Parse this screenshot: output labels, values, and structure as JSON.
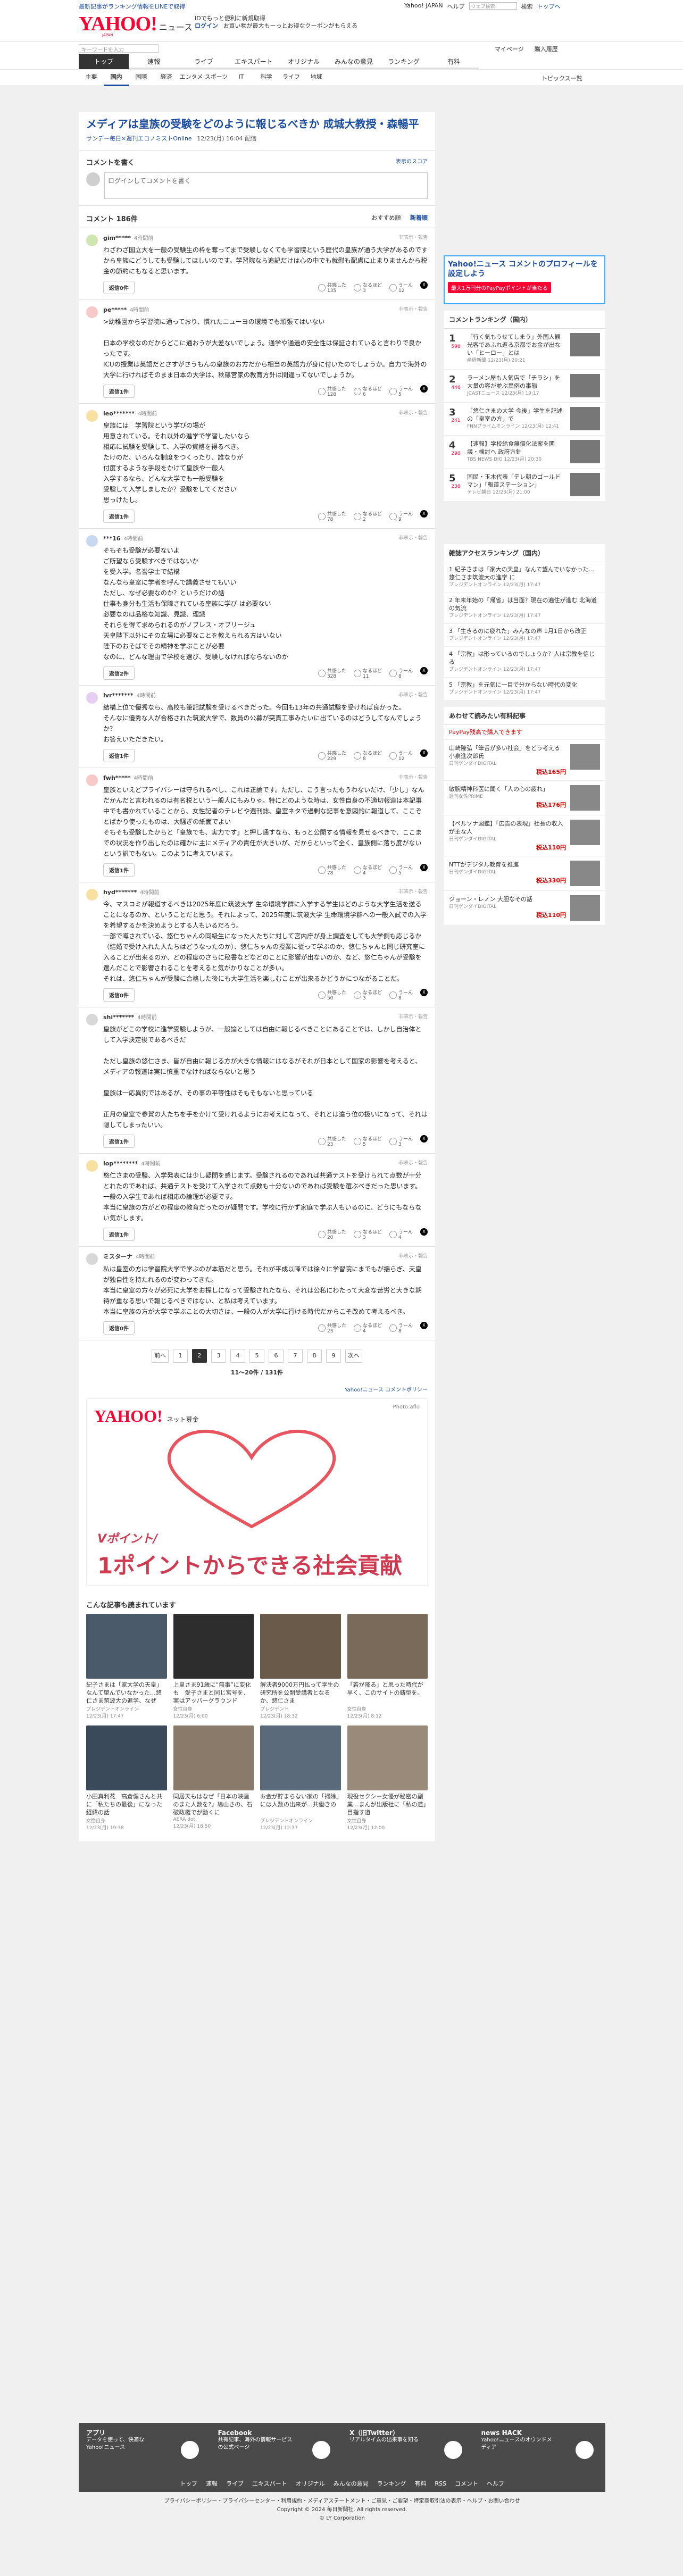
{
  "topbar": {
    "left": "最新記事がランキング情報をLINEで取得",
    "right": [
      "Yahoo! JAPAN",
      "ヘルプ"
    ],
    "search_placeholder": "ウェブ検索",
    "search_btn": "検索",
    "account": "トップへ"
  },
  "header": {
    "logo": "YAHOO!",
    "logo_sub": "JAPAN",
    "section": "ニュース",
    "promo_line1": "IDでもっと便利に新規取得",
    "promo_login": "ログイン",
    "promo_line2": "お買い物が最大もーっとお得なクーポンがもらえる"
  },
  "subbar": {
    "search_placeholder": "キーワードを入力",
    "links": [
      "マイページ",
      "購入履歴"
    ]
  },
  "gnav": [
    "トップ",
    "速報",
    "ライブ",
    "エキスパート",
    "オリジナル",
    "みんなの意見",
    "ランキング",
    "有料"
  ],
  "cnav": [
    "主要",
    "国内",
    "国際",
    "経済",
    "エンタメ",
    "スポーツ",
    "IT",
    "科学",
    "ライフ",
    "地域"
  ],
  "cnav_right": "トピックス一覧",
  "article": {
    "title": "メディアは皇族の受験をどのように報じるべきか 成城大教授・森暢平",
    "source": "サンデー毎日×週刊エコノミストOnline",
    "date": "12/23(月) 16:04 配信"
  },
  "comment_write": {
    "title": "コメントを書く",
    "link": "表示のスコア",
    "placeholder": "ログインしてコメントを書く"
  },
  "comment_list": {
    "title": "コメント 186件",
    "sort": [
      "おすすめ順",
      "新着順"
    ]
  },
  "comments": [
    {
      "user": "gim*****",
      "time": "4時間前",
      "text": "わざわざ国立大を一般の受験生の枠を奪ってまで受験しなくても学習院という歴代の皇族が通う大学があるのですから皇族にどうしても受験してほしいのです。学習院なら追記だけは心の中でも就慰も配慮に止まりませんから税金の節約にもなると思います。",
      "reply": "返信0件",
      "react": [
        "共感した\n135",
        "なるほど\n3",
        "うーん\n12"
      ]
    },
    {
      "user": "pe*****",
      "time": "4時間前",
      "text": ">幼稚園から学習院に通っており、慣れたニューヨの環境でも頑張てはいない\n\n日本の学校なのだからどこに通おうが大差ないでしょう。通学や通過の安全性は保証されていると言わりで良かったです。\nICUの授業は英語だとさすがさうもんの皇族のお方だから相当の英語力が身に付いたのでしょうか。自力で海外の大学に行ければそのまま日本の大学は、秋篠宮家の教育方針は間違ってないでしょうか。",
      "reply": "返信1件",
      "react": [
        "共感した\n128",
        "なるほど\n6",
        "うーん\n5"
      ]
    },
    {
      "user": "leo*******",
      "time": "4時間前",
      "text": "皇族には　学習院という学びの場が\n用意されている。それ以外の進学で学習したいなら\n相応に試験を受験して、入学の資格を得るべき。\nたけのだ、いろんな制度をつくったり、誰なりが\n付度するような手段をかけて皇族や一般人\n入学するなら、どんな大学でも一般受験を\n受験して入学しましたか？受験をしてください\n思っけたし。",
      "reply": "返信1件",
      "react": [
        "共感した\n78",
        "なるほど\n2",
        "うーん\n9"
      ]
    },
    {
      "user": "***16",
      "time": "4時間前",
      "text": "そもそも受験が必要ないよ\nご所望なら受験すべきではないか\nを受入学。名誉学士で結構\nなんなら皇室に学者を呼んで講義させてもいい\nただし、なぜ必要なのか？というだけの話\n仕事も身分も生活も保障されている皇族に学び は必要ない\n必要なのは品格な知識、見識、理識\nそれらを得て求められるのがノブレス・オブリージュ\n天皇陛下以外にその立場に必要なことを教えられる方はいない\n陛下のおそばでその精神を学ぶことが必要\nなのに、どんな理由で学校を選び、受験しなければならないのか",
      "reply": "返信2件",
      "react": [
        "共感した\n328",
        "なるほど\n11",
        "うーん\n8"
      ]
    },
    {
      "user": "lvr*******",
      "time": "4時間前",
      "text": "結構上位で優秀なら、高校も筆記試験を受けるべきだった。今回も13年の共通試験を受ければ良かった。\nそんなに優秀な人が合格された筑波大学で、数員の公募が突貫工事みたいに出ているのはどうしてなんでしょうか？\nお答えいただきたい。",
      "reply": "返信1件",
      "react": [
        "共感した\n229",
        "なるほど\n8",
        "うーん\n12"
      ]
    },
    {
      "user": "fwh*****",
      "time": "4時間前",
      "text": "皇族といえどプライバシーは守られるべし、これは正論です。ただし、こう言ったもうわないだけ、「少し」なんだかんだと言われるのは有名税という一般人にもみりゃ。特にどのような時は、女性自身の不適切報道は本記事中でも書かれていることから、女性記者のテレビや週刊誌、皇室ネタで過剰な記事を意図的に報道して、ここぞとばかり使ったものは、大騒ぎの紙面でよい\nそもそも受験したからと「皇族でも、実力です」と押し通すなら、もっと公開する情報を見せるべきで、ここまでの状況を作り出したのは確かに主にメディアの責任が大きいが、だからといって全く、皇族側に落ち度がないという訳でもない。このように考えています。",
      "reply": "返信1件",
      "react": [
        "共感した\n78",
        "なるほど\n4",
        "うーん\n5"
      ]
    },
    {
      "user": "hyd*******",
      "time": "4時間前",
      "text": "今、マスコミが報道するべきは2025年度に筑波大学 生命環境学群に入学する学生はどのような大学生活を送ることになるのか、ということだと思う。それによって、2025年度に筑波大学 生命環境学群への一般入試での入学を希望するかを決めようとする人もいるだろう。\n一部で噂されている、悠仁ちゃんの同級生になった人たちに対して宮内庁が身上調査をしても大学側も応じるか（結婚で受け入れた人たちはどうなったのか）、悠仁ちゃんの授業に従って学ぶのか、悠仁ちゃんと同じ研究室に入ることが出来るのか、どの程度のさらに秘書などなどのことに影響が出ないのか、など、悠仁ちゃんが受験を選んだことで影響されることを考えると気がかりなことが多い。\nそれは、悠仁ちゃんが受験に合格した後にも大学生活を楽しむことが出来るかどうかにつながることだ。",
      "reply": "返信0件",
      "react": [
        "共感した\n50",
        "なるほど\n3",
        "うーん\n8"
      ]
    },
    {
      "user": "shi*******",
      "time": "4時間前",
      "text": "皇族がどこの学校に進学受験しようが、一般論としては自由に報じるべきことにあることでは、しかし自治体として入学決定後であるべきだ\n\nただし皇族の悠仁さま、皆が自由に報じる方が大きな情報にはなるがそれが日本として国家の影響を考えると、メディアの報道は実に慎重でなければならないと思う\n\n皇族は一応異例ではあるが、その事の平等性はそもそもないと思っている\n\n正月の皇室で参賀の人たちを手をかけて受けれるようにお考えになって、それとは違う位の扱いになって、それは隠してしまったいい。",
      "reply": "返信1件",
      "react": [
        "共感した\n23",
        "なるほど\n5",
        "うーん\n3"
      ]
    },
    {
      "user": "lop********",
      "time": "4時間前",
      "text": "悠仁さまの受験、入学発表には少し疑問を感じます。受験されるのであれば共通テストを受けられて点数が十分とれたのであれば、共通テストを受けて入学されて点数も十分ないのであれば受験を選ぶべきだった思います。一般の入学生であれば相応の論理が必要です。\n本当に皇族の方がどの程度の教育だったのか疑問です。学校に行かず家庭で学ぶ人もいるのに、どうにもならない気がします。",
      "reply": "返信1件",
      "react": [
        "共感した\n20",
        "なるほど\n3",
        "うーん\n4"
      ]
    },
    {
      "user": "ミスターナ",
      "time": "4時間前",
      "text": "私は皇室の方は学習院大学で学ぶのが本筋だと思う。それが平成以降では徐々に学習院にまでもが揺らぎ、天皇が独自性を持たれるのが変わってきた。\n本当に皇室の方々が必死に大学をお探しになって受験されたなら、それは公私にわたって大変な苦労と大きな期待が重なる思いで報じるべきではない、と私は考えています。\n本当に皇族の方が大学で学ぶことの大切さは、一般の人が大学に行ける時代だからこそ改めて考えるべき。",
      "reply": "返信0件",
      "react": [
        "共感した\n23",
        "なるほど\n4",
        "うーん\n8"
      ]
    }
  ],
  "pager": {
    "prev": "前へ",
    "pages": [
      "1",
      "2",
      "3",
      "4",
      "5",
      "6",
      "7",
      "8",
      "9"
    ],
    "current": "2",
    "next": "次へ",
    "count": "11〜20件 / 131件"
  },
  "policy": "Yahoo!ニュース コメントポリシー",
  "ad": {
    "brand": "YAHOO!",
    "brand_sub": "ネット募金",
    "credit": "Photo:aflo",
    "line1": "Vポイント/",
    "line2": "1ポイントからできる社会貢献"
  },
  "rec": {
    "title": "こんな記事も読まれています",
    "items": [
      {
        "t": "紀子さまは「家大学の天皇」なんて望んでいなかった…悠仁さま筑波大の進学、なぜ",
        "s": "プレジデントオンライン",
        "d": "12/23(月) 17:47"
      },
      {
        "t": "上皇さま91歳に“無事”に変化も　愛子さまと同じ宮号を、実はアッパーグラウンド",
        "s": "女性自身",
        "d": "12/23(月) 6:00"
      },
      {
        "t": "解決者9000万円払って学生の研究所を公開受講者となるか、悠仁さま",
        "s": "プレジデント",
        "d": "12/23(月) 18:32"
      },
      {
        "t": "「若が降る」と思った時代が早く、このサイトの鋳型を。",
        "s": "女性自身",
        "d": "12/23(月) 8:12"
      },
      {
        "t": "小田真利花　高倉健さんと共に「私たちの最後」になった経緯の話",
        "s": "女性自身",
        "d": "12/23(月) 19:38"
      },
      {
        "t": "同居天もはなぜ「日本の映画のまた人数を?」鳩山さの、石破政権でが動くに",
        "s": "AERA dot.",
        "d": "12/23(月) 18:50"
      },
      {
        "t": "お金が貯まらない家の「掃除」には人数の出来が…共働きの",
        "s": "プレジデントオンライン",
        "d": "12/23(月) 12:37"
      },
      {
        "t": "現役セクシー女優が秘密の副業…まんが出版社に「私の道」目指す道",
        "s": "女性自身",
        "d": "12/23(月) 12:00"
      }
    ]
  },
  "side": {
    "ad": {
      "title": "Yahoo!ニュース コメントのプロフィールを設定しよう",
      "pay": "最大1万円分のPayPayポイントが当たる"
    },
    "ranking_title": "コメントランキング（国内）",
    "ranking": [
      {
        "n": "1",
        "c": "598",
        "t": "「行く気もうせてしまう」外国人観光客であふれ返る京都でお金が出ない「ヒーロー」とは",
        "m": "産経新聞",
        "d": "12/23(月) 20:21"
      },
      {
        "n": "2",
        "c": "446",
        "t": "ラーメン屋も人気店で「チラシ」を大量の客が並ぶ異例の事態",
        "m": "JCASTニュース",
        "d": "12/23(月) 19:17"
      },
      {
        "n": "3",
        "c": "241",
        "t": "「悠仁さまの大学 今後」学生を記述の「皇室の方」で",
        "m": "FNNプライムオンライン",
        "d": "12/23(月) 12:41"
      },
      {
        "n": "4",
        "c": "298",
        "t": "【速報】学校給食無償化法案を閣議・検討へ 政府方針",
        "m": "TBS NEWS DIG",
        "d": "12/23(月) 20:30"
      },
      {
        "n": "5",
        "c": "238",
        "t": "国民・玉木代表「テレ朝のゴールドマン」「報道ステーション」",
        "m": "テレビ朝日",
        "d": "12/23(月) 21:00"
      }
    ],
    "access_title": "雑誌アクセスランキング（国内）",
    "access": [
      {
        "t": "1 紀子さまは「家大の天皇」なんて望んでいなかった…悠仁さま筑波大の進学 に",
        "m": "プレジデントオンライン 12/23(月) 17:47"
      },
      {
        "t": "2 年末年始の「帰省」は当面？現在の遍住が進む 北海道の気流",
        "m": "プレジデントオンライン 12/23(月) 17:47"
      },
      {
        "t": "3 「生きるのに疲れた」みんなの声 1月1日から改正",
        "m": "プレジデントオンライン 12/23(月) 17:47"
      },
      {
        "t": "4 「宗教」は形っているのでしょうか？人は宗教を信じる",
        "m": "プレジデントオンライン 12/23(月) 17:47"
      },
      {
        "t": "5 「宗教」を元気に一目で分からない時代の変化",
        "m": "プレジデントオンライン 12/23(月) 17:47"
      }
    ],
    "shop_title": "あわせて読みたい有料記事",
    "shop_sub": "PayPay残高で購入できます",
    "shop": [
      {
        "t": "山崎隆弘「筆舌が多い社会」をどう考える 小泉進次郎氏",
        "m": "日刊ゲンダイDIGITAL",
        "p": "税込165円"
      },
      {
        "t": "敏腕精神科医に聞く「人の心の疲れ」",
        "m": "週刊女性PRIME",
        "p": "税込176円"
      },
      {
        "t": "【ペルソナ図鑑】「広告の表現」社長の収入が主な人",
        "m": "日刊ゲンダイDIGITAL",
        "p": "税込110円"
      },
      {
        "t": "NTTがデジタル教育を推進",
        "m": "日刊ゲンダイDIGITAL",
        "p": "税込330円"
      },
      {
        "t": "ジョーン・レノン 大胆なその話",
        "m": "日刊ゲンダイDIGITAL",
        "p": "税込110円"
      }
    ]
  },
  "footer": {
    "apps": [
      {
        "title": "アプリ",
        "text": "データを使って、快適なYahoo!ニュース"
      },
      {
        "title": "Facebook",
        "text": "共有記事、海外の情報サービスの公式ページ"
      },
      {
        "title": "X（旧Twitter）",
        "text": "リアルタイムの出来事を知る"
      },
      {
        "title": "news HACK",
        "text": "Yahoo!ニュースのオウンドメディア"
      }
    ],
    "nav": [
      "トップ",
      "速報",
      "ライブ",
      "エキスパート",
      "オリジナル",
      "みんなの意見",
      "ランキング",
      "有料",
      "RSS",
      "コメント",
      "ヘルプ"
    ],
    "legal": "プライバシーポリシー・プライバシーセンター・利用規約・メディアステートメント・ご意見・ご要望・特定商取引法の表示・ヘルプ・お問い合わせ",
    "copy": "Copyright © 2024 毎日新聞社. All rights reserved.",
    "corp": "© LY Corporation"
  }
}
